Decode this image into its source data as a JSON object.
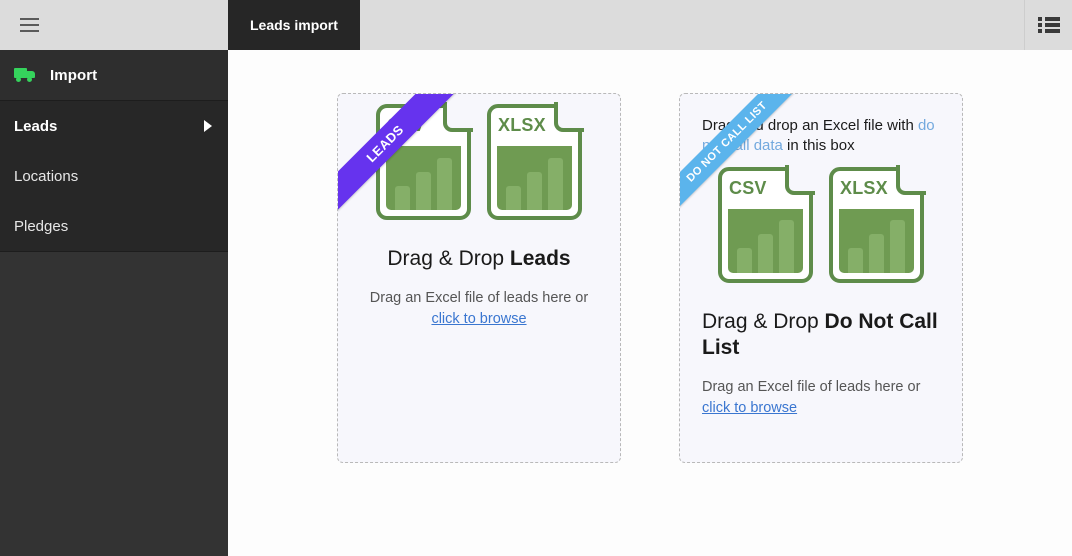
{
  "sidebar": {
    "menu_icon": "hamburger-icon",
    "section": {
      "icon": "truck-icon",
      "label": "Import"
    },
    "items": [
      {
        "label": "Leads",
        "active": true,
        "arrow": "chevron-right-icon"
      },
      {
        "label": "Locations",
        "active": false
      },
      {
        "label": "Pledges",
        "active": false
      }
    ]
  },
  "topbar": {
    "tab_label": "Leads import",
    "right_icon": "list-view-icon"
  },
  "dropzones": [
    {
      "ribbon": "LEADS",
      "ribbon_color": "#6633ee",
      "hint": "",
      "hint_highlight": "",
      "hint_tail": "",
      "files": [
        {
          "type": "CSV",
          "bars": [
            40,
            62,
            85
          ]
        },
        {
          "type": "XLSX",
          "bars": [
            40,
            62,
            85
          ]
        }
      ],
      "title_prefix": "Drag & Drop ",
      "title_strong": "Leads",
      "sub_text": "Drag an Excel file of leads here or ",
      "sub_link": "click to browse"
    },
    {
      "ribbon": "DO NOT CALL LIST",
      "ribbon_color": "#5bb4ec",
      "hint": "Drag and drop an Excel file with ",
      "hint_highlight": "do not call data",
      "hint_tail": " in this box",
      "files": [
        {
          "type": "CSV",
          "bars": [
            40,
            62,
            85
          ]
        },
        {
          "type": "XLSX",
          "bars": [
            40,
            62,
            85
          ]
        }
      ],
      "title_prefix": "Drag & Drop ",
      "title_strong": "Do Not Call List",
      "sub_text": "Drag an Excel file of leads here or ",
      "sub_link": "click to browse"
    }
  ],
  "colors": {
    "sidebar_bg": "#333333",
    "topbar_bg": "#dcdcdc",
    "tab_bg": "#262626",
    "accent_green": "#35d35c",
    "file_green": "#5e8c4a",
    "link_blue": "#3a76d0",
    "content_bg": "#fdfdfd"
  }
}
